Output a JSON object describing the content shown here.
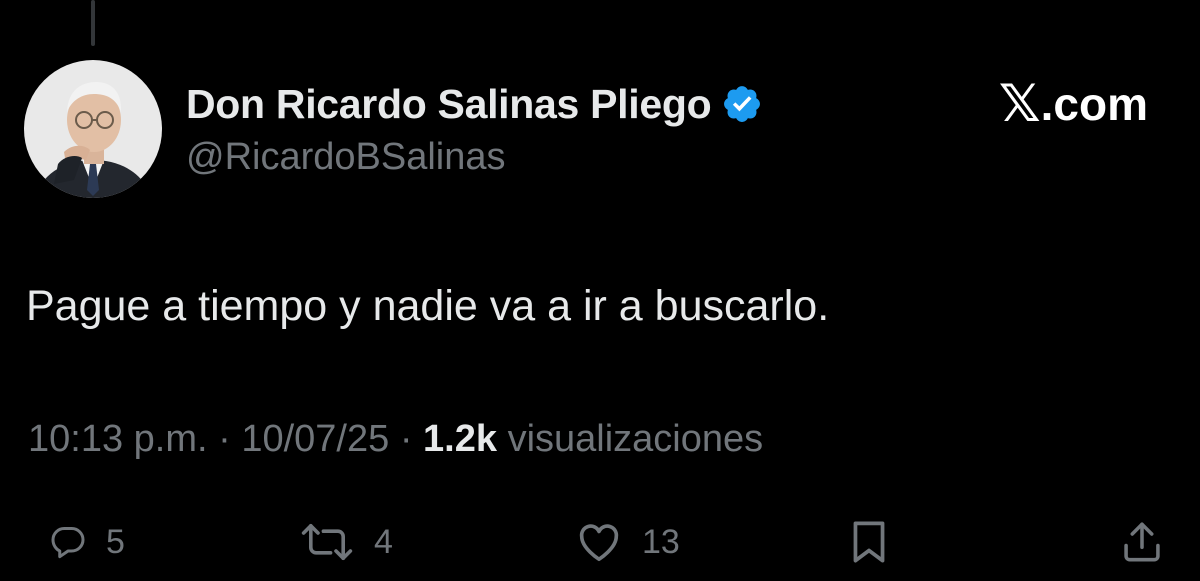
{
  "author": {
    "display_name": "Don Ricardo Salinas Pliego",
    "handle": "@RicardoBSalinas",
    "verified": true,
    "verified_color": "#1d9bf0"
  },
  "brand": {
    "logo_glyph": "𝕏",
    "text": ".com"
  },
  "tweet": {
    "text": "Pague a tiempo y nadie va a ir a buscarlo."
  },
  "meta": {
    "time": "10:13 p.m.",
    "separator": "·",
    "date": "10/07/25",
    "views_count": "1.2k",
    "views_label": "visualizaciones"
  },
  "actions": {
    "replies": "5",
    "reposts": "4",
    "likes": "13"
  },
  "icons": {
    "reply": "reply-icon",
    "repost": "repost-icon",
    "like": "heart-icon",
    "bookmark": "bookmark-icon",
    "share": "share-icon",
    "verified": "verified-badge-icon"
  },
  "colors": {
    "background": "#000000",
    "primary_text": "#e7e9ea",
    "secondary_text": "#71767b",
    "accent": "#1d9bf0"
  }
}
